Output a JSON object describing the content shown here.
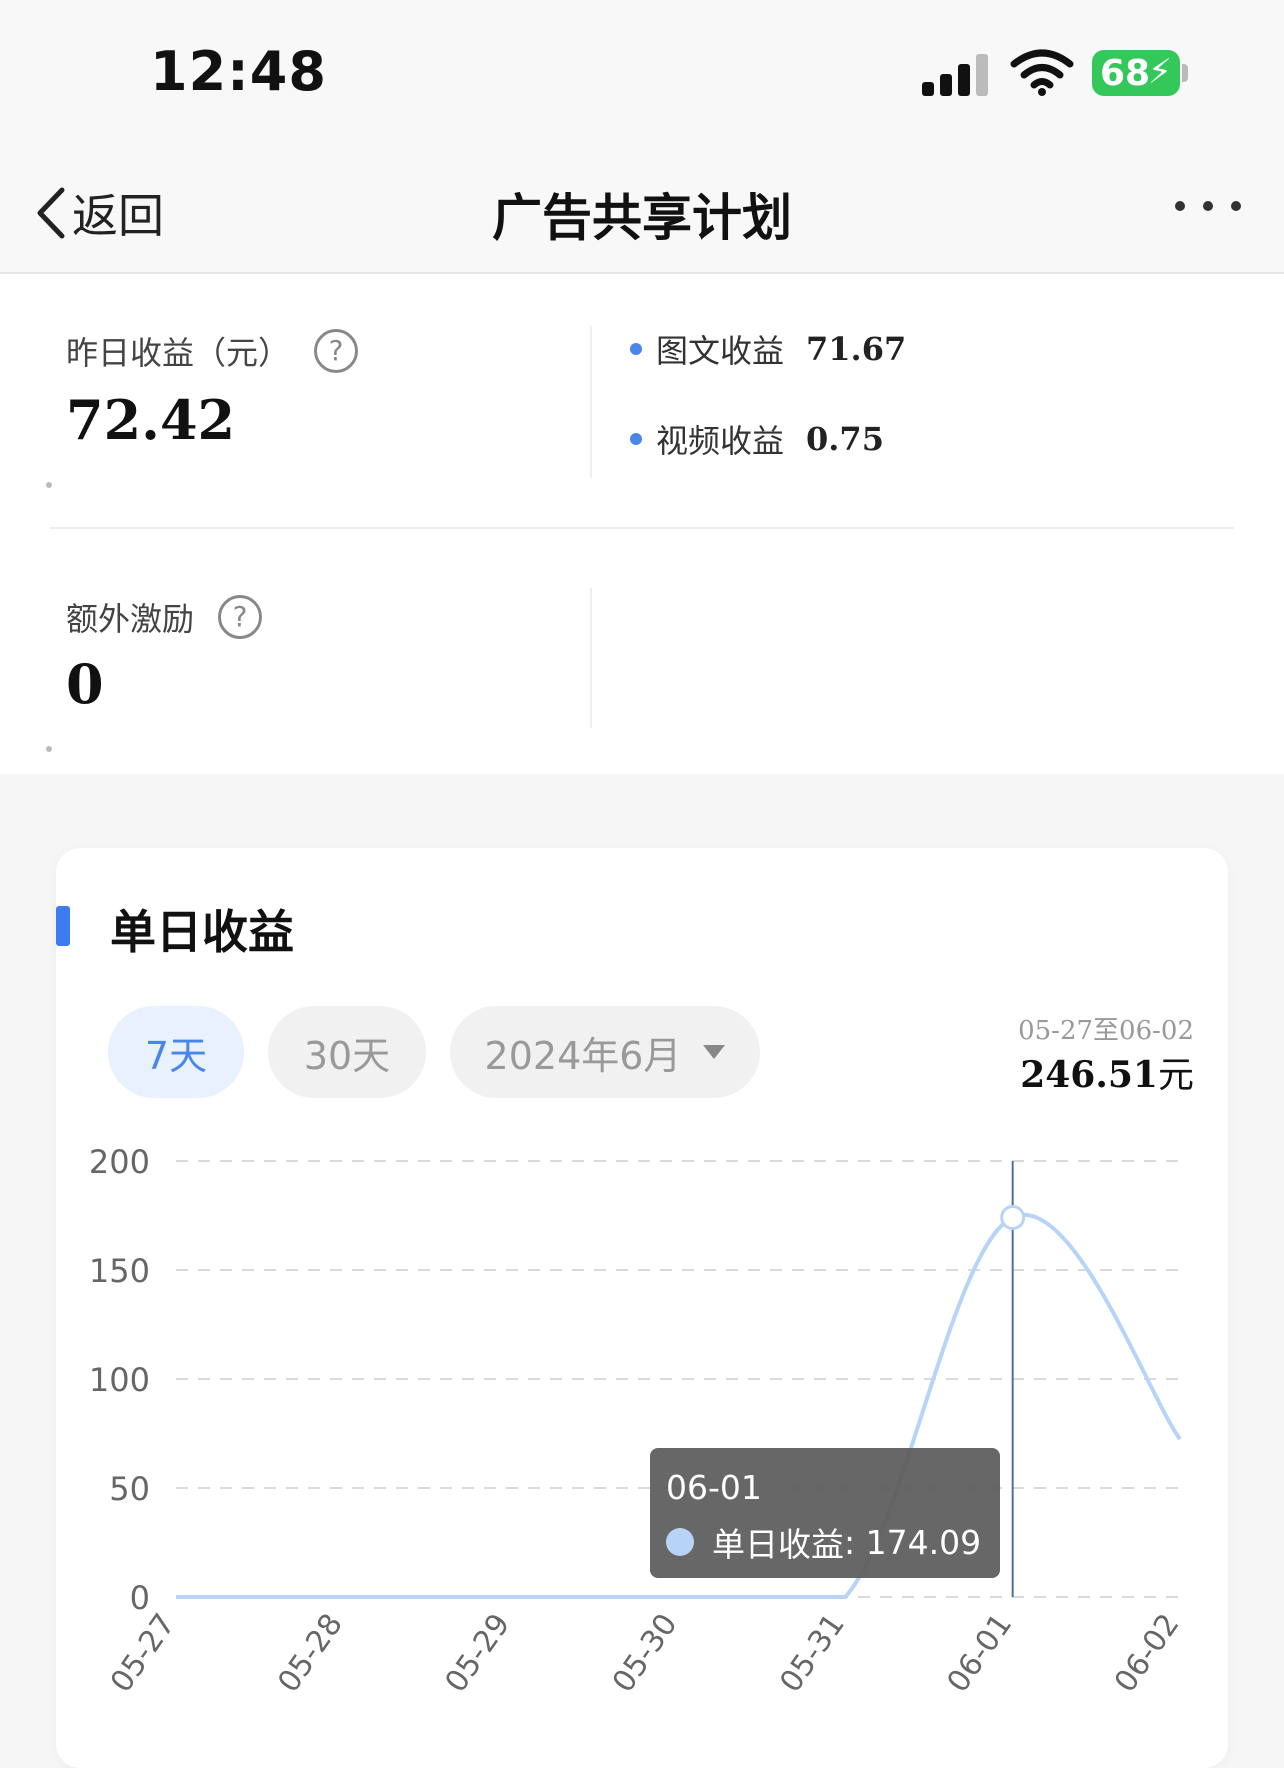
{
  "status_bar": {
    "time": "12:48",
    "battery": "68"
  },
  "nav": {
    "back_label": "返回",
    "title": "广告共享计划"
  },
  "stats": {
    "yesterday": {
      "label": "昨日收益（元）",
      "value": "72.42"
    },
    "breakdown": [
      {
        "label": "图文收益",
        "value": "71.67"
      },
      {
        "label": "视频收益",
        "value": "0.75"
      }
    ],
    "extra": {
      "label": "额外激励",
      "value": "0"
    }
  },
  "card": {
    "title": "单日收益",
    "filters": [
      "7天",
      "30天",
      "2024年6月"
    ],
    "active_filter": "7天",
    "range_label": "05-27至06-02",
    "range_total": "246.51",
    "range_unit": "元"
  },
  "tooltip": {
    "date": "06-01",
    "series": "单日收益",
    "value": "174.09"
  },
  "colors": {
    "accent": "#3d7bf2",
    "line": "#b7d4f8",
    "battery": "#34c759"
  },
  "chart_data": {
    "type": "line",
    "categories": [
      "05-27",
      "05-28",
      "05-29",
      "05-30",
      "05-31",
      "06-01",
      "06-02"
    ],
    "series": [
      {
        "name": "单日收益",
        "values": [
          0,
          0,
          0,
          0,
          0,
          174.09,
          72.42
        ]
      }
    ],
    "ylim": [
      0,
      200
    ],
    "yticks": [
      0,
      50,
      100,
      150,
      200
    ],
    "grid": true,
    "highlight_index": 5
  }
}
